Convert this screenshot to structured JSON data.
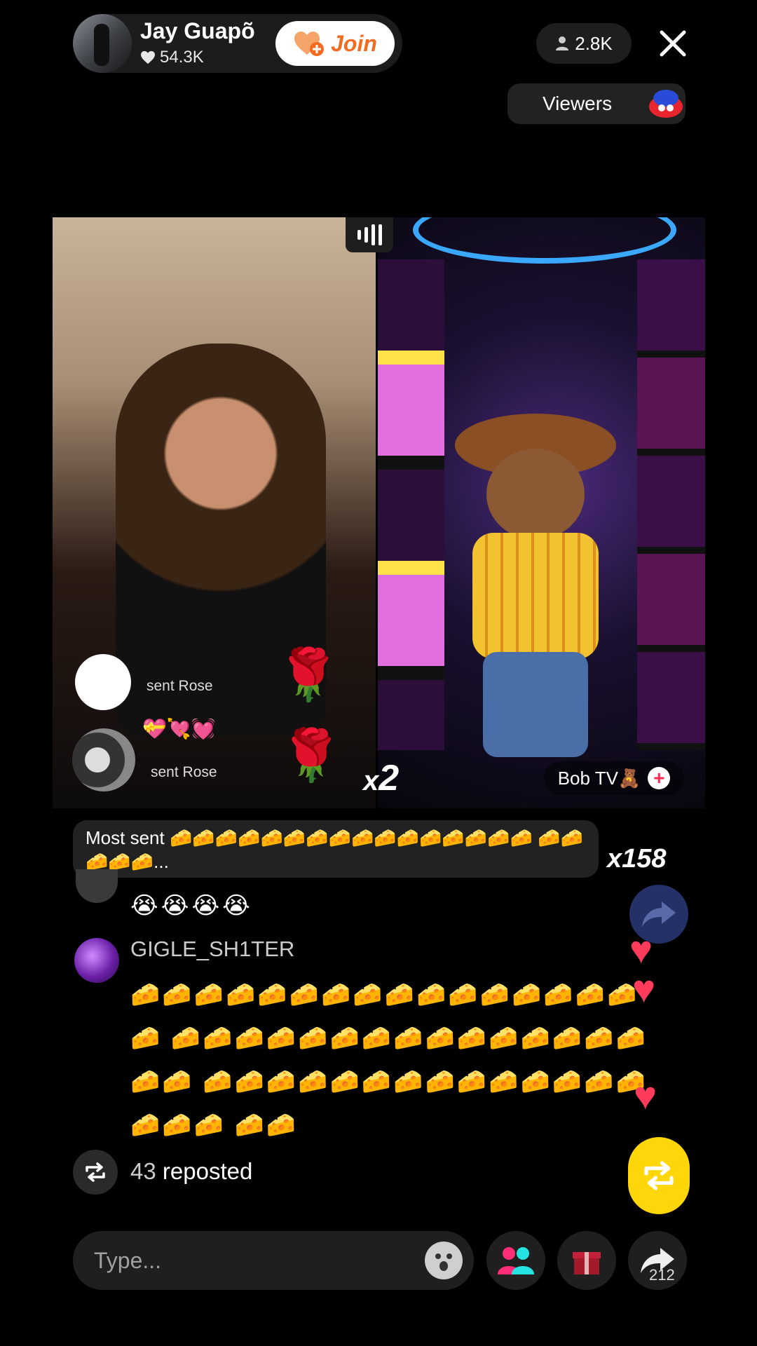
{
  "host": {
    "name": "Jay Guapõ",
    "likes": "54.3K",
    "join_label": "Join"
  },
  "viewer_count": "2.8K",
  "viewers_label": "Viewers",
  "gifts": [
    {
      "text": "sent Rose",
      "emoji": "🌹"
    },
    {
      "text": "sent Rose",
      "emoji": "🌹",
      "badges": "💝💘💓"
    }
  ],
  "combo": {
    "prefix": "x",
    "value": "2"
  },
  "guest": {
    "name": "Bob TV🧸"
  },
  "most_sent": {
    "label": "Most sent",
    "emojis": "🧀🧀🧀🧀🧀🧀🧀🧀🧀🧀🧀🧀🧀🧀🧀🧀 🧀🧀🧀🧀🧀...",
    "count": "x158"
  },
  "chat": [
    {
      "name": "",
      "message": "😭😭😭😭"
    },
    {
      "name": "GIGLE_SH1TER",
      "message": "🧀🧀🧀🧀🧀🧀🧀🧀🧀🧀🧀🧀🧀🧀🧀🧀🧀 🧀🧀🧀🧀🧀🧀🧀🧀🧀🧀🧀🧀🧀🧀🧀🧀🧀 🧀🧀🧀🧀🧀🧀🧀🧀🧀🧀🧀🧀🧀🧀🧀🧀🧀 🧀🧀"
    }
  ],
  "reposted": {
    "count": "43",
    "label": "reposted"
  },
  "input": {
    "placeholder": "Type..."
  },
  "share_count": "212"
}
